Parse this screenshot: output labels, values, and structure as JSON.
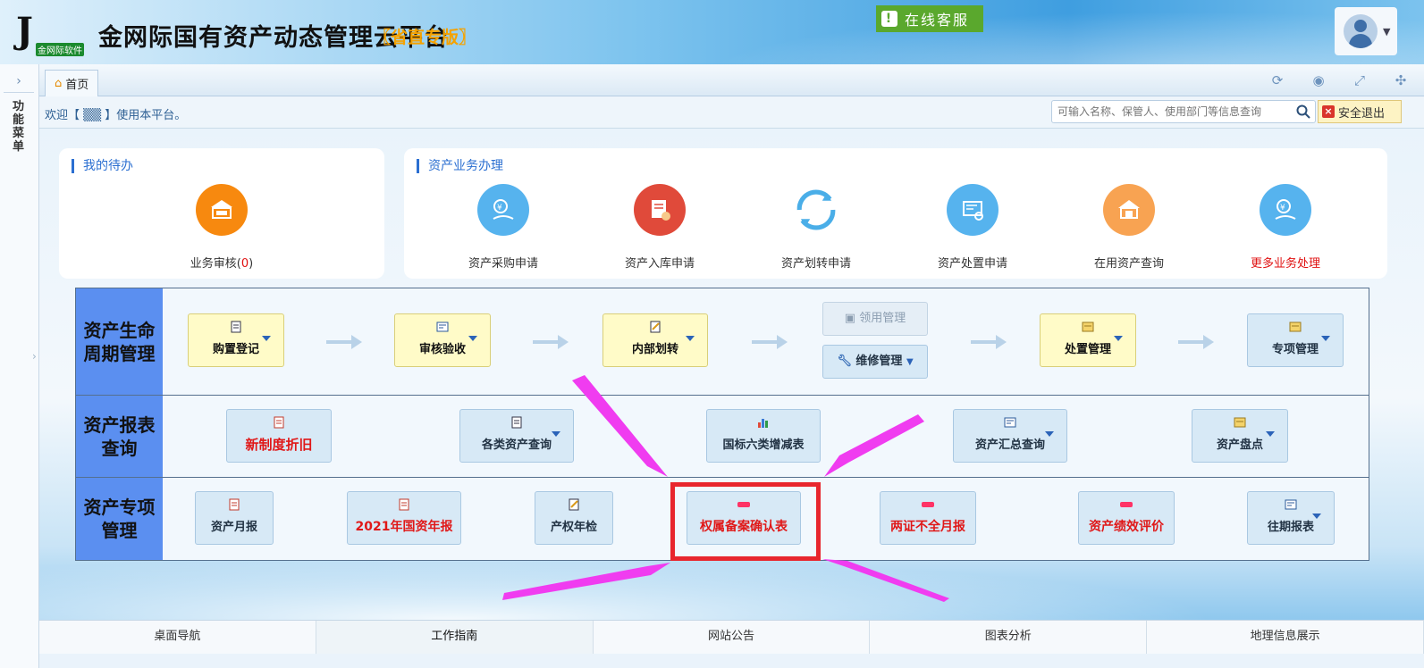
{
  "header": {
    "logo_mark": "J",
    "logo_text": "金网际软件",
    "title": "金网际国有资产动态管理云平台",
    "subtitle": "〖省直专版〗",
    "service_label": "在线客服",
    "service_icon": "!"
  },
  "sidebar": {
    "toggle": "›",
    "label": "功能菜单"
  },
  "tabs": {
    "home": "首页"
  },
  "welcome": {
    "text": "欢迎【 ▒▒ 】使用本平台。",
    "search_placeholder": "可输入名称、保管人、使用部门等信息查询",
    "logout_label": "安全退出"
  },
  "todo": {
    "title": "我的待办",
    "item_label": "业务审核(",
    "item_count": "0",
    "item_close": ")"
  },
  "business": {
    "title": "资产业务办理",
    "items": [
      {
        "label": "资产采购申请"
      },
      {
        "label": "资产入库申请"
      },
      {
        "label": "资产划转申请"
      },
      {
        "label": "资产处置申请"
      },
      {
        "label": "在用资产查询"
      },
      {
        "label": "更多业务处理"
      }
    ]
  },
  "lifecycle": {
    "head": "资产生命周期管理",
    "items": [
      "购置登记",
      "审核验收",
      "内部划转",
      "领用管理",
      "维修管理",
      "处置管理",
      "专项管理"
    ]
  },
  "reports": {
    "head": "资产报表查询",
    "items": [
      "新制度折旧",
      "各类资产查询",
      "国标六类增减表",
      "资产汇总查询",
      "资产盘点"
    ]
  },
  "special": {
    "head": "资产专项管理",
    "items": [
      "资产月报",
      "2021年国资年报",
      "产权年检",
      "权属备案确认表",
      "两证不全月报",
      "资产绩效评价",
      "往期报表"
    ]
  },
  "bottom_tabs": [
    "桌面导航",
    "工作指南",
    "网站公告",
    "图表分析",
    "地理信息展示"
  ],
  "colors": {
    "accent_blue": "#2b6fd1",
    "row_head": "#5b8ff0",
    "highlight": "#e8262d",
    "annotation_arrow": "#f03cf0",
    "logout_bg": "#fdf3c4"
  }
}
